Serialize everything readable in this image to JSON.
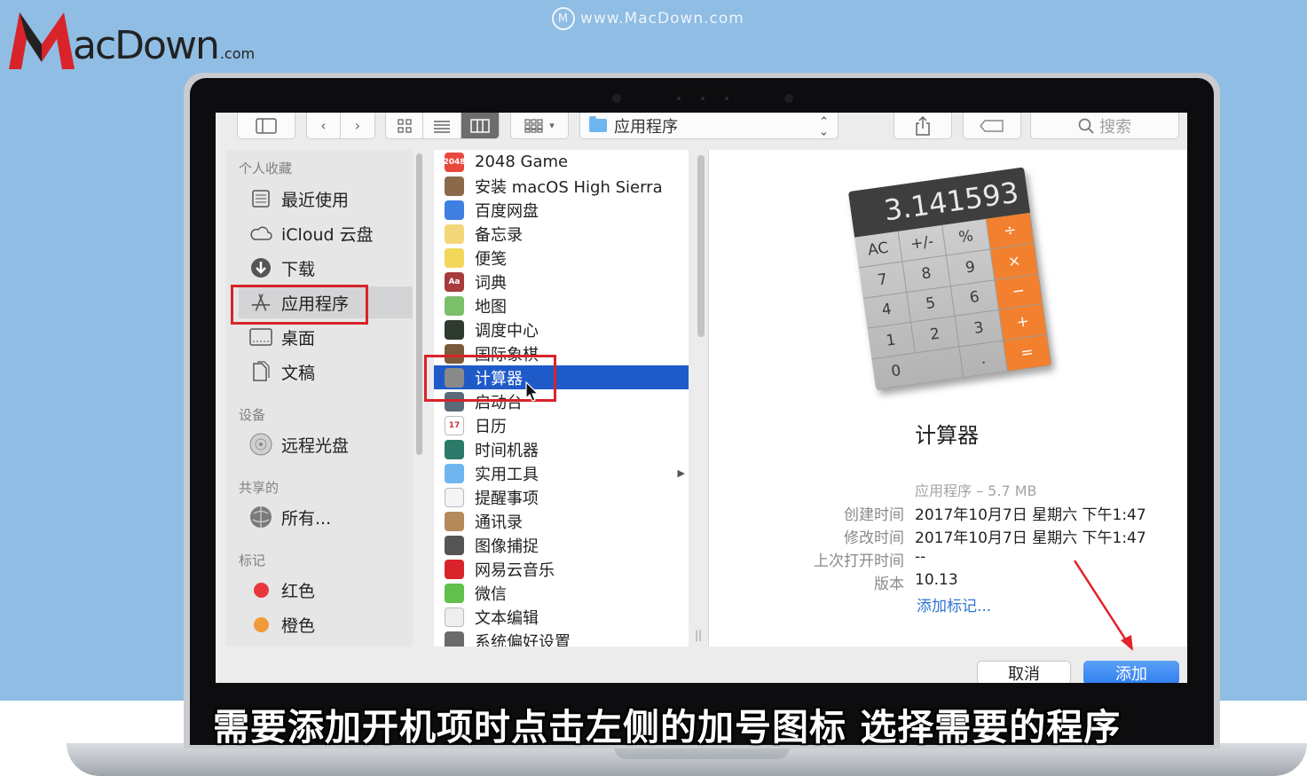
{
  "logo": {
    "text": "acDown",
    "dotcom": ".com"
  },
  "watermark": {
    "circle": "M",
    "text": "www.MacDown.com"
  },
  "toolbar": {
    "path_label": "应用程序",
    "search_placeholder": "搜索"
  },
  "sidebar": {
    "sections": {
      "favorites": "个人收藏",
      "devices": "设备",
      "shared": "共享的",
      "tags": "标记"
    },
    "favorites": [
      {
        "label": "最近使用",
        "icon": "recents-icon"
      },
      {
        "label": "iCloud 云盘",
        "icon": "icloud-icon"
      },
      {
        "label": "下载",
        "icon": "download-icon"
      },
      {
        "label": "应用程序",
        "icon": "applications-icon",
        "selected": true
      },
      {
        "label": "桌面",
        "icon": "desktop-icon"
      },
      {
        "label": "文稿",
        "icon": "documents-icon"
      }
    ],
    "devices": [
      {
        "label": "远程光盘",
        "icon": "disc-icon"
      }
    ],
    "shared": [
      {
        "label": "所有...",
        "icon": "network-icon"
      }
    ],
    "tags": [
      {
        "label": "红色",
        "color": "#e8383d"
      },
      {
        "label": "橙色",
        "color": "#f29a38"
      }
    ]
  },
  "files": [
    {
      "name": "2048 Game",
      "icon": "game-2048-icon",
      "color": "#e8483e",
      "badge": "2048"
    },
    {
      "name": "安装 macOS High Sierra",
      "icon": "install-macos-icon",
      "color": "#8a6a4a",
      "badge": ""
    },
    {
      "name": "百度网盘",
      "icon": "baidu-netdisk-icon",
      "color": "#3f7fe0",
      "badge": ""
    },
    {
      "name": "备忘录",
      "icon": "notes-icon",
      "color": "#f4d67a",
      "badge": ""
    },
    {
      "name": "便笺",
      "icon": "stickies-icon",
      "color": "#f2d75b",
      "badge": ""
    },
    {
      "name": "词典",
      "icon": "dictionary-icon",
      "color": "#a83b3b",
      "badge": "Aa"
    },
    {
      "name": "地图",
      "icon": "maps-icon",
      "color": "#7cbf6a",
      "badge": ""
    },
    {
      "name": "调度中心",
      "icon": "mission-control-icon",
      "color": "#2e3a2e",
      "badge": ""
    },
    {
      "name": "国际象棋",
      "icon": "chess-icon",
      "color": "#7a5a3a",
      "badge": ""
    },
    {
      "name": "计算器",
      "icon": "calculator-icon",
      "color": "#8a8a8a",
      "badge": "",
      "selected": true
    },
    {
      "name": "启动台",
      "icon": "launchpad-icon",
      "color": "#5a6a7a",
      "badge": ""
    },
    {
      "name": "日历",
      "icon": "calendar-icon",
      "color": "#ffffff",
      "badge": "17"
    },
    {
      "name": "时间机器",
      "icon": "time-machine-icon",
      "color": "#2c7a6a",
      "badge": ""
    },
    {
      "name": "实用工具",
      "icon": "utilities-folder-icon",
      "color": "#6fb6f0",
      "badge": "",
      "folder": true
    },
    {
      "name": "提醒事项",
      "icon": "reminders-icon",
      "color": "#f4f4f4",
      "badge": ""
    },
    {
      "name": "通讯录",
      "icon": "contacts-icon",
      "color": "#b58a5a",
      "badge": ""
    },
    {
      "name": "图像捕捉",
      "icon": "image-capture-icon",
      "color": "#555555",
      "badge": ""
    },
    {
      "name": "网易云音乐",
      "icon": "netease-music-icon",
      "color": "#d8232a",
      "badge": ""
    },
    {
      "name": "微信",
      "icon": "wechat-icon",
      "color": "#5fc04a",
      "badge": ""
    },
    {
      "name": "文本编辑",
      "icon": "textedit-icon",
      "color": "#eeeeee",
      "badge": ""
    },
    {
      "name": "系统偏好设置",
      "icon": "system-preferences-icon",
      "color": "#6a6a6a",
      "badge": ""
    }
  ],
  "preview": {
    "display": "3.141593",
    "keys": [
      "AC",
      "+/-",
      "%",
      "÷",
      "7",
      "8",
      "9",
      "×",
      "4",
      "5",
      "6",
      "−",
      "1",
      "2",
      "3",
      "+",
      "0",
      ".",
      "="
    ],
    "name": "计算器",
    "kind": "应用程序 – 5.7 MB",
    "rows": [
      {
        "label": "创建时间",
        "value": "2017年10月7日 星期六 下午1:47"
      },
      {
        "label": "修改时间",
        "value": "2017年10月7日 星期六 下午1:47"
      },
      {
        "label": "上次打开时间",
        "value": "--"
      },
      {
        "label": "版本",
        "value": "10.13"
      }
    ],
    "add_tags_link": "添加标记..."
  },
  "buttons": {
    "cancel": "取消",
    "add": "添加"
  },
  "subtitle": "需要添加开机项时点击左侧的加号图标 选择需要的程序",
  "colors": {
    "accent": "#1f5bc8",
    "highlight_box": "#d8232a",
    "background": "#8fbde3"
  }
}
